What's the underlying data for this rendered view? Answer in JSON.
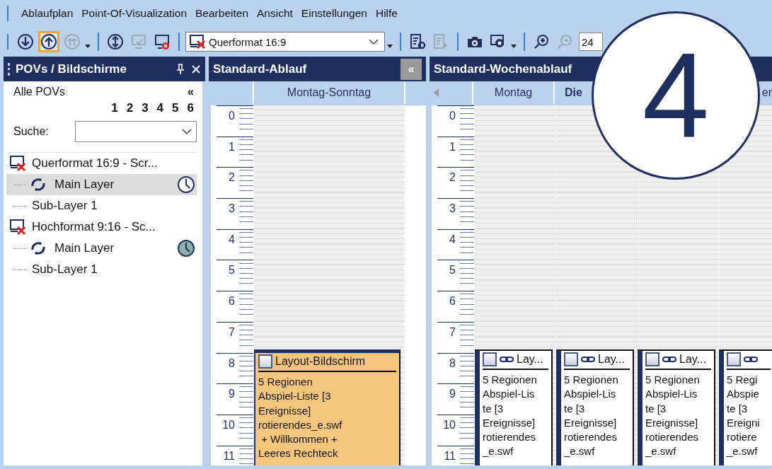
{
  "menu": [
    "Ablaufplan",
    "Point-Of-Visualization",
    "Bearbeiten",
    "Ansicht",
    "Einstellungen",
    "Hilfe"
  ],
  "toolbar": {
    "buttons": [
      {
        "kind": "down",
        "disabled": false,
        "selected": false
      },
      {
        "kind": "up",
        "disabled": false,
        "selected": true
      },
      {
        "kind": "upmulti",
        "disabled": true,
        "selected": false
      },
      {
        "kind": "caret"
      },
      {
        "kind": "sep"
      },
      {
        "kind": "updown",
        "disabled": false,
        "selected": false
      },
      {
        "kind": "monitorcheck",
        "disabled": true,
        "selected": false
      },
      {
        "kind": "monitorx",
        "disabled": false,
        "selected": false
      },
      {
        "kind": "sep"
      },
      {
        "kind": "combo"
      },
      {
        "kind": "caret"
      },
      {
        "kind": "sep"
      },
      {
        "kind": "docgear",
        "disabled": false,
        "selected": false
      },
      {
        "kind": "docplay",
        "disabled": true,
        "selected": false
      },
      {
        "kind": "sep"
      },
      {
        "kind": "camera",
        "disabled": false,
        "selected": false
      },
      {
        "kind": "cameramonitor",
        "disabled": false,
        "selected": false
      },
      {
        "kind": "caret"
      },
      {
        "kind": "sep"
      },
      {
        "kind": "zoomin",
        "disabled": false,
        "selected": false
      },
      {
        "kind": "zoomout",
        "disabled": true,
        "selected": false
      },
      {
        "kind": "field"
      }
    ],
    "combo_value": "Querformat 16:9",
    "field_value": "24"
  },
  "povs": {
    "title": "POVs / Bildschirme",
    "all_label": "Alle POVs",
    "collapse": "«",
    "numbers": [
      "1",
      "2",
      "3",
      "4",
      "5",
      "6"
    ],
    "search_label": "Suche:",
    "tree": [
      {
        "label": "Querformat 16:9 - Scr...",
        "selected": false,
        "children": [
          {
            "label": "Main Layer",
            "kind": "main",
            "selected": true,
            "clock_filled": false
          },
          {
            "label": "Sub-Layer 1",
            "kind": "sub",
            "selected": false
          }
        ]
      },
      {
        "label": "Hochformat 9:16 - Sc...",
        "selected": false,
        "children": [
          {
            "label": "Main Layer",
            "kind": "main",
            "selected": false,
            "clock_filled": true
          },
          {
            "label": "Sub-Layer 1",
            "kind": "sub",
            "selected": false
          }
        ]
      }
    ]
  },
  "standard": {
    "title": "Standard-Ablauf",
    "collapse": "«",
    "column": "Montag-Sonntag",
    "hours": [
      "0",
      "1",
      "2",
      "3",
      "4",
      "5",
      "6",
      "7",
      "8",
      "9",
      "10",
      "11"
    ],
    "event": {
      "title": "Layout-Bildschirm",
      "lines": [
        "5 Regionen",
        "Abspiel-Liste [3",
        "Ereignisse]",
        "rotierendes_e.swf",
        " + Willkommen +",
        "Leeres Rechteck"
      ]
    }
  },
  "weekly": {
    "title": "Standard-Wochenablauf",
    "hours": [
      "0",
      "1",
      "2",
      "3",
      "4",
      "5",
      "6",
      "7",
      "8",
      "9",
      "10",
      "11"
    ],
    "columns": [
      {
        "label": "Montag",
        "current": false,
        "event": {
          "title": "Lay...",
          "lines": [
            "5 Regionen",
            "Abspiel-Lis",
            "te [3",
            "Ereignisse]",
            "rotierendes",
            "_e.swf"
          ]
        }
      },
      {
        "label": "Die",
        "current": true,
        "event": {
          "title": "Lay...",
          "lines": [
            "5 Regionen",
            "Abspiel-Lis",
            "te [3",
            "Ereignisse]",
            "rotierendes",
            "_e.swf"
          ]
        }
      },
      {
        "event": {
          "title": "Lay...",
          "lines": [
            "5 Regionen",
            "Abspiel-Lis",
            "te [3",
            "Ereignisse]",
            "rotierendes",
            "_e.swf"
          ]
        }
      },
      {
        "label": "er",
        "current": false,
        "event": {
          "lines": [
            "5 Regi",
            "Abspie",
            "te [3",
            "Ereigni",
            "rotiere",
            "_e.swf"
          ]
        }
      }
    ]
  },
  "step_badge": "4"
}
